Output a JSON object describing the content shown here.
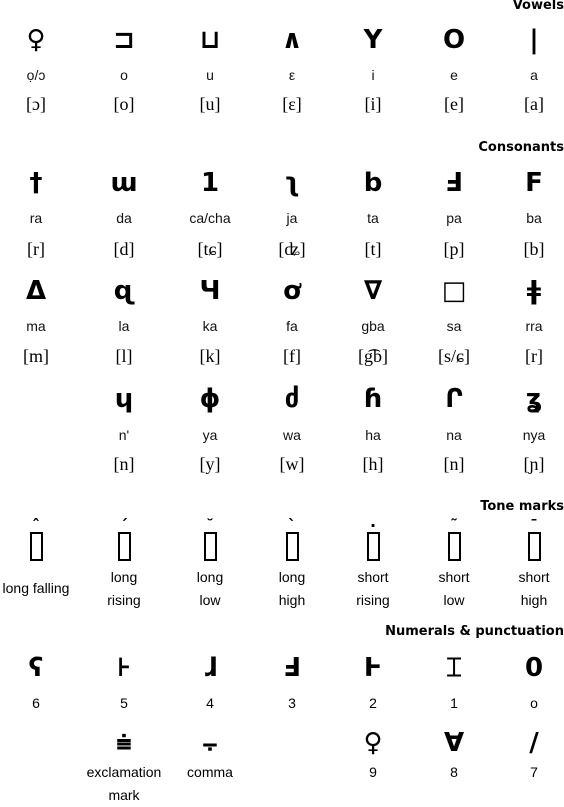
{
  "sections": {
    "vowels": "Vowels",
    "consonants": "Consonants",
    "tones": "Tone marks",
    "numerals": "Numerals & punctuation"
  },
  "vowels": [
    {
      "glyph": "♀",
      "roman": "ọ/ɔ",
      "ipa": "[ɔ]"
    },
    {
      "glyph": "⊐",
      "roman": "o",
      "ipa": "[o]"
    },
    {
      "glyph": "⊔",
      "roman": "u",
      "ipa": "[u]"
    },
    {
      "glyph": "∧",
      "roman": "ε",
      "ipa": "[ɛ]"
    },
    {
      "glyph": "Y",
      "roman": "i",
      "ipa": "[i]"
    },
    {
      "glyph": "O",
      "roman": "e",
      "ipa": "[e]"
    },
    {
      "glyph": "|",
      "roman": "a",
      "ipa": "[a]"
    }
  ],
  "consonants": [
    [
      {
        "glyph": "†",
        "roman": "ra",
        "ipa": "[r]"
      },
      {
        "glyph": "ɯ",
        "roman": "da",
        "ipa": "[d]"
      },
      {
        "glyph": "1",
        "roman": "ca/cha",
        "ipa": "[tɕ]"
      },
      {
        "glyph": "ʅ",
        "roman": "ja",
        "ipa": "[ʥ]"
      },
      {
        "glyph": "b",
        "roman": "ta",
        "ipa": "[t]"
      },
      {
        "glyph": "Ⅎ",
        "roman": "pa",
        "ipa": "[p]"
      },
      {
        "glyph": "F",
        "roman": "ba",
        "ipa": "[b]"
      }
    ],
    [
      {
        "glyph": "Δ",
        "roman": "ma",
        "ipa": "[m]"
      },
      {
        "glyph": "ɋ",
        "roman": "la",
        "ipa": "[l]"
      },
      {
        "glyph": "Ч",
        "roman": "ka",
        "ipa": "[k]"
      },
      {
        "glyph": "ơ",
        "roman": "fa",
        "ipa": "[f]"
      },
      {
        "glyph": "∇",
        "roman": "gba",
        "ipa": "[g͡b]"
      },
      {
        "glyph": "□",
        "roman": "sa",
        "ipa": "[s/ɕ]"
      },
      {
        "glyph": "ǂ",
        "roman": "rra",
        "ipa": "[r]"
      }
    ],
    [
      null,
      {
        "glyph": "ɥ",
        "roman": "n'",
        "ipa": "[n]"
      },
      {
        "glyph": "ϕ",
        "roman": "ya",
        "ipa": "[y]"
      },
      {
        "glyph": "ძ",
        "roman": "wa",
        "ipa": "[w]"
      },
      {
        "glyph": "ɦ",
        "roman": "ha",
        "ipa": "[h]"
      },
      {
        "glyph": "Ր",
        "roman": "na",
        "ipa": "[n]"
      },
      {
        "glyph": "ʓ",
        "roman": "nya",
        "ipa": "[ɲ]"
      }
    ]
  ],
  "tones": [
    {
      "mark": "ˆ",
      "label": [
        "long falling"
      ]
    },
    {
      "mark": "ˊ",
      "label": [
        "long",
        "rising"
      ]
    },
    {
      "mark": "˘",
      "label": [
        "long",
        "low"
      ]
    },
    {
      "mark": "ˋ",
      "label": [
        "long",
        "high"
      ]
    },
    {
      "mark": "·",
      "label": [
        "short",
        "rising"
      ]
    },
    {
      "mark": "˜",
      "label": [
        "short",
        "low"
      ]
    },
    {
      "mark": "¯",
      "label": [
        "short",
        "high"
      ]
    }
  ],
  "numerals": [
    [
      {
        "glyph": "ʕ",
        "label": [
          "6"
        ]
      },
      {
        "glyph": "⊦",
        "label": [
          "5"
        ]
      },
      {
        "glyph": "ɺ",
        "label": [
          "4"
        ]
      },
      {
        "glyph": "Ⅎ",
        "label": [
          "3"
        ]
      },
      {
        "glyph": "Ͱ",
        "label": [
          "2"
        ]
      },
      {
        "glyph": "⌶",
        "label": [
          "1"
        ]
      },
      {
        "glyph": "0",
        "label": [
          "o"
        ]
      }
    ],
    [
      null,
      {
        "glyph": "⩧",
        "label": [
          "exclamation",
          "mark"
        ]
      },
      {
        "glyph": "⨪",
        "label": [
          "comma"
        ]
      },
      null,
      {
        "glyph": "♀",
        "label": [
          "9"
        ]
      },
      {
        "glyph": "Ɐ",
        "label": [
          "8"
        ]
      },
      {
        "glyph": "/",
        "label": [
          "7"
        ]
      }
    ]
  ]
}
